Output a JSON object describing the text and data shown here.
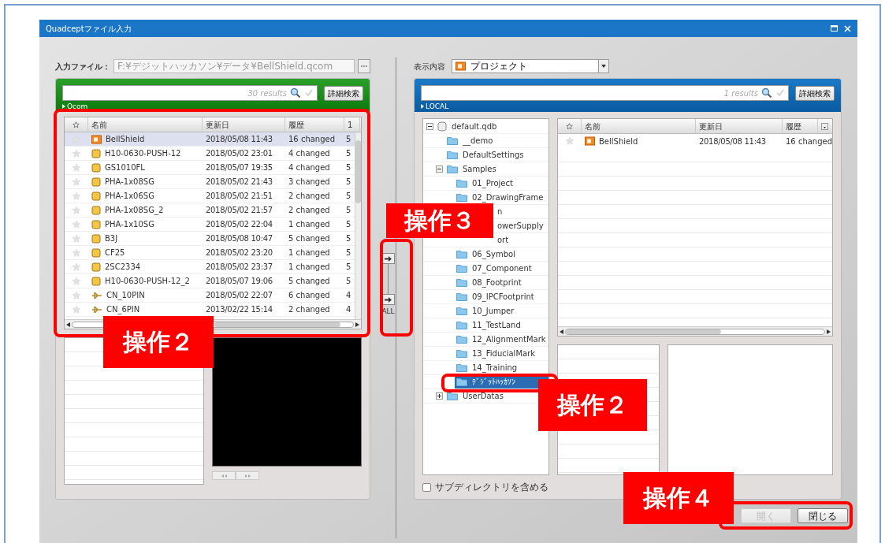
{
  "window": {
    "title": "Quadceptファイル入力"
  },
  "left": {
    "input_label": "入力ファイル：",
    "input_value": "F:¥デジットハッカソン¥データ¥BellShield.qcom",
    "search": {
      "results": "30 results",
      "button": "詳細検索",
      "source": "Qcom"
    },
    "table": {
      "columns": [
        "名前",
        "更新日",
        "履歴",
        "1"
      ],
      "rows": [
        {
          "kind": "project",
          "name": "BellShield",
          "date": "2018/05/08 11:43",
          "history": "16 changed",
          "column_5": "5",
          "selected": true
        },
        {
          "kind": "part",
          "name": "H10-0630-PUSH-12",
          "date": "2018/05/02 23:01",
          "history": "4 changed",
          "column_5": "5",
          "selected": false
        },
        {
          "kind": "part",
          "name": "GS1010FL",
          "date": "2018/05/07 19:35",
          "history": "4 changed",
          "column_5": "5",
          "selected": false
        },
        {
          "kind": "part",
          "name": "PHA-1x08SG",
          "date": "2018/05/02 21:43",
          "history": "3 changed",
          "column_5": "5",
          "selected": false
        },
        {
          "kind": "part",
          "name": "PHA-1x06SG",
          "date": "2018/05/02 21:51",
          "history": "2 changed",
          "column_5": "5",
          "selected": false
        },
        {
          "kind": "part",
          "name": "PHA-1x08SG_2",
          "date": "2018/05/02 21:57",
          "history": "2 changed",
          "column_5": "5",
          "selected": false
        },
        {
          "kind": "part",
          "name": "PHA-1x10SG",
          "date": "2018/05/02 22:04",
          "history": "1 changed",
          "column_5": "5",
          "selected": false
        },
        {
          "kind": "part",
          "name": "B3J",
          "date": "2018/05/08 10:47",
          "history": "5 changed",
          "column_5": "5",
          "selected": false
        },
        {
          "kind": "part",
          "name": "CF25",
          "date": "2018/05/02 23:20",
          "history": "1 changed",
          "column_5": "5",
          "selected": false
        },
        {
          "kind": "part",
          "name": "2SC2334",
          "date": "2018/05/02 23:37",
          "history": "1 changed",
          "column_5": "5",
          "selected": false
        },
        {
          "kind": "part",
          "name": "H10-0630-PUSH-12_2",
          "date": "2018/05/07 19:06",
          "history": "5 changed",
          "column_5": "5",
          "selected": false
        },
        {
          "kind": "connector",
          "name": "CN_10PIN",
          "date": "2018/05/02 22:07",
          "history": "6 changed",
          "column_5": "4",
          "selected": false
        },
        {
          "kind": "connector",
          "name": "CN_6PIN",
          "date": "2013/02/22 15:14",
          "history": "2 changed",
          "column_5": "4",
          "selected": false
        }
      ]
    }
  },
  "middle": {
    "all_label": "ALL"
  },
  "right": {
    "display_label": "表示内容",
    "display_value": "プロジェクト",
    "search": {
      "results": "1 results",
      "button": "詳細検索",
      "source": "LOCAL"
    },
    "tree": [
      {
        "kind": "database",
        "label": "default.qdb",
        "expanded": true,
        "selected": false,
        "children": [
          {
            "kind": "folder",
            "label": "__demo",
            "selected": false
          },
          {
            "kind": "folder",
            "label": "DefaultSettings",
            "selected": false
          },
          {
            "kind": "folder",
            "label": "Samples",
            "expanded": true,
            "selected": false,
            "children": [
              {
                "kind": "folder",
                "label": "01_Project",
                "selected": false
              },
              {
                "kind": "folder",
                "label": "02_DrawingFrame",
                "selected": false
              },
              {
                "kind": "partial",
                "label": "n",
                "selected": false
              },
              {
                "kind": "partial",
                "label": "owerSupply",
                "selected": false
              },
              {
                "kind": "partial",
                "label": "ort",
                "selected": false
              },
              {
                "kind": "folder",
                "label": "06_Symbol",
                "selected": false
              },
              {
                "kind": "folder",
                "label": "07_Component",
                "selected": false
              },
              {
                "kind": "folder",
                "label": "08_Footprint",
                "selected": false
              },
              {
                "kind": "folder",
                "label": "09_IPCFootprint",
                "selected": false
              },
              {
                "kind": "folder",
                "label": "10_Jumper",
                "selected": false
              },
              {
                "kind": "folder",
                "label": "11_TestLand",
                "selected": false
              },
              {
                "kind": "folder",
                "label": "12_AlignmentMark",
                "selected": false
              },
              {
                "kind": "folder",
                "label": "13_FiducialMark",
                "selected": false
              },
              {
                "kind": "folder",
                "label": "14_Training",
                "selected": false
              },
              {
                "kind": "folder",
                "label": "ﾃﾞｼﾞｯﾄﾊｯｶｿﾝ",
                "selected": true
              }
            ]
          },
          {
            "kind": "folder",
            "label": "UserDatas",
            "expanded": false,
            "selected": false
          }
        ]
      }
    ],
    "table": {
      "columns": [
        "名前",
        "更新日",
        "履歴"
      ],
      "rows": [
        {
          "kind": "project",
          "name": "BellShield",
          "date": "2018/05/08 11:43",
          "history": "16 changed",
          "selected": false
        }
      ]
    },
    "subdir": {
      "label": "サブディレクトリを含める",
      "checked": false
    },
    "buttons": [
      {
        "label": "開く",
        "disabled": true
      },
      {
        "label": "閉じる",
        "disabled": false
      }
    ]
  },
  "callouts": [
    "操作２",
    "操作３",
    "操作２",
    "操作４"
  ]
}
